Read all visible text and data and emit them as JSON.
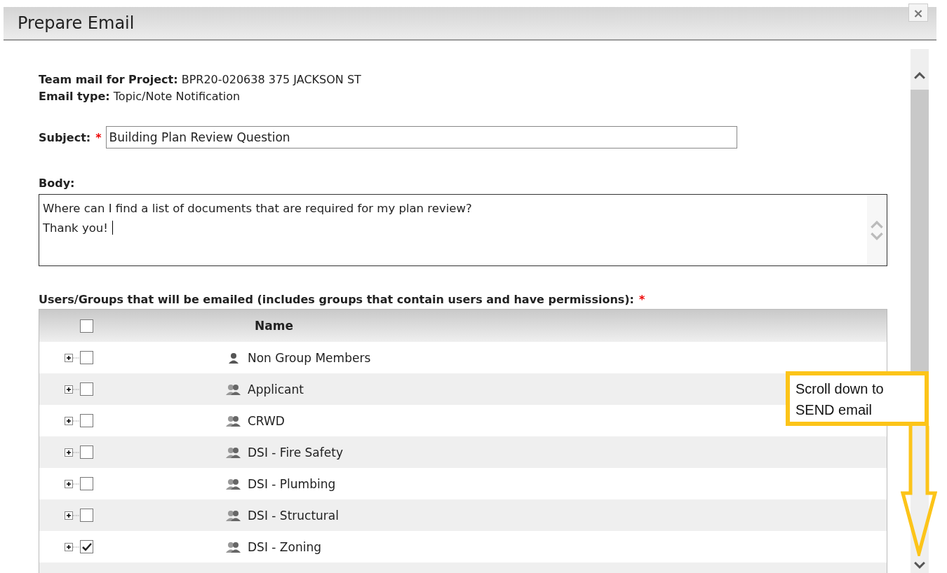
{
  "dialog": {
    "title": "Prepare Email",
    "close": "×"
  },
  "info": [
    {
      "label": "Team mail for Project:",
      "value": "BPR20-020638 375 JACKSON ST"
    },
    {
      "label": "Email type:",
      "value": "Topic/Note Notification"
    }
  ],
  "subject": {
    "label": "Subject:",
    "required": true,
    "required_mark": "*",
    "value": "Building Plan Review Question"
  },
  "body": {
    "label": "Body:",
    "lines": [
      "Where can I find a list of documents that are required for my plan review?",
      "Thank you!"
    ]
  },
  "recipients": {
    "label": "Users/Groups that will be emailed (includes groups that contain users and have permissions):",
    "required": true,
    "required_mark": "*",
    "header": {
      "checked": false,
      "name": "Name"
    },
    "rows": [
      {
        "name": "Non Group Members",
        "kind": "person",
        "checked": false,
        "expanded": false
      },
      {
        "name": "Applicant",
        "kind": "group",
        "checked": false,
        "expanded": false
      },
      {
        "name": "CRWD",
        "kind": "group",
        "checked": false,
        "expanded": false
      },
      {
        "name": "DSI - Fire Safety",
        "kind": "group",
        "checked": false,
        "expanded": false
      },
      {
        "name": "DSI - Plumbing",
        "kind": "group",
        "checked": false,
        "expanded": false
      },
      {
        "name": "DSI - Structural",
        "kind": "group",
        "checked": false,
        "expanded": false
      },
      {
        "name": "DSI - Zoning",
        "kind": "group",
        "checked": true,
        "expanded": false
      }
    ]
  },
  "callout": {
    "text": "Scroll down to SEND email"
  }
}
